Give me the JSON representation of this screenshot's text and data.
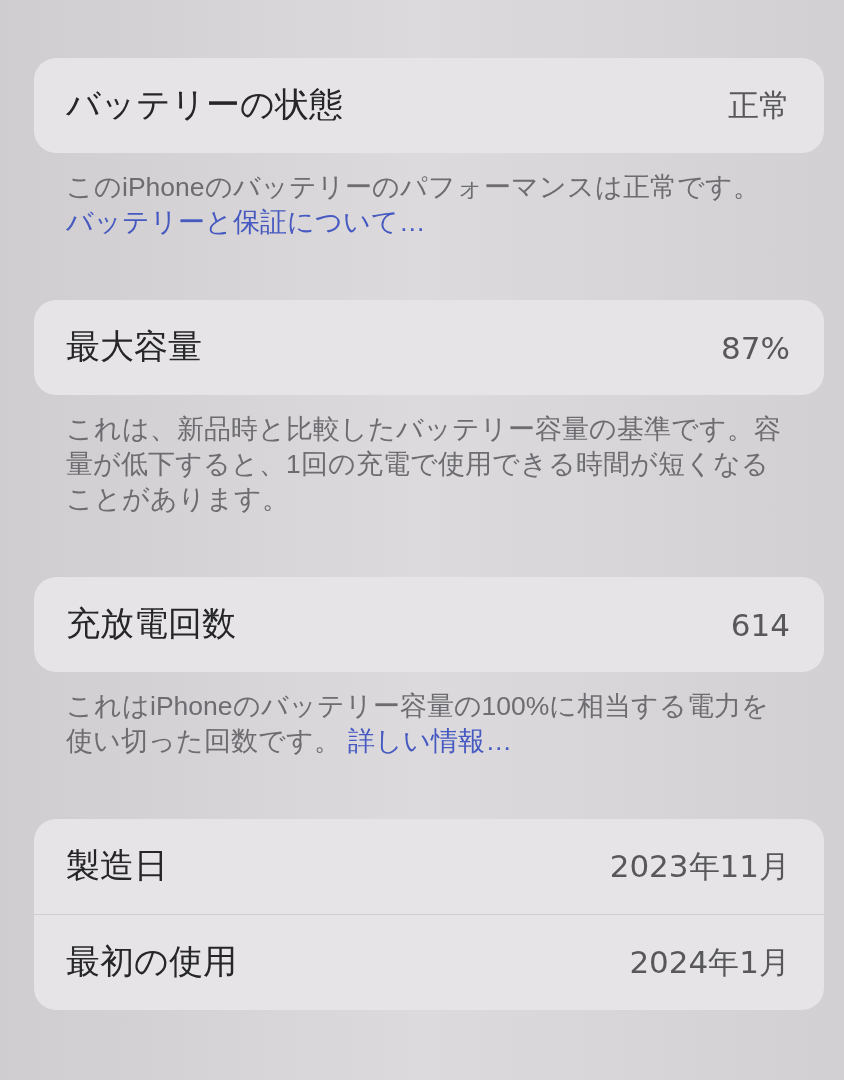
{
  "sections": [
    {
      "rows": [
        {
          "label": "バッテリーの状態",
          "value": "正常"
        }
      ],
      "footer": {
        "text": "このiPhoneのバッテリーのパフォーマンスは正常です。",
        "link": "バッテリーと保証について…"
      }
    },
    {
      "rows": [
        {
          "label": "最大容量",
          "value": "87%"
        }
      ],
      "footer": {
        "text": "これは、新品時と比較したバッテリー容量の基準です。容量が低下すると、1回の充電で使用できる時間が短くなることがあります。"
      }
    },
    {
      "rows": [
        {
          "label": "充放電回数",
          "value": "614"
        }
      ],
      "footer": {
        "text": "これはiPhoneのバッテリー容量の100%に相当する電力を使い切った回数です。",
        "link": "詳しい情報…"
      }
    },
    {
      "rows": [
        {
          "label": "製造日",
          "value": "2023年11月"
        },
        {
          "label": "最初の使用",
          "value": "2024年1月"
        }
      ]
    }
  ]
}
